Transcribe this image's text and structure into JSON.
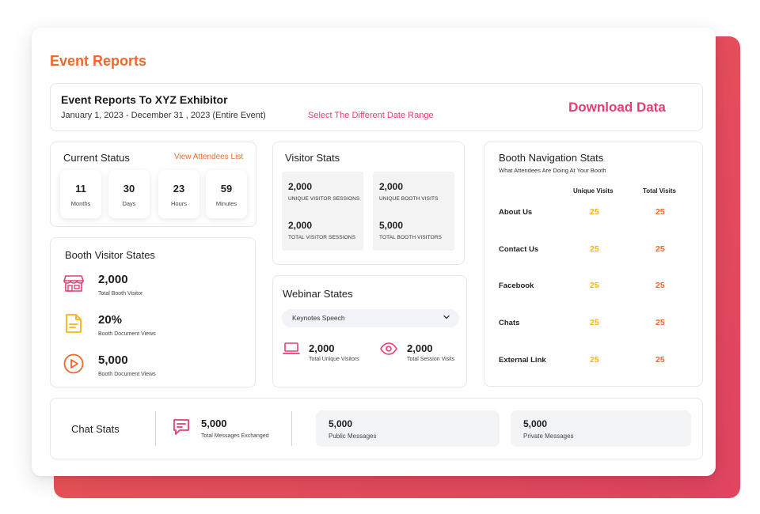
{
  "page_title": "Event Reports",
  "header": {
    "title": "Event Reports To XYZ Exhibitor",
    "date_range": "January 1, 2023 - December 31 , 2023 (Entire Event)",
    "select_range_link": "Select The Different Date Range",
    "download_label": "Download Data"
  },
  "current_status": {
    "title": "Current Status",
    "view_link": "View Attendees List",
    "boxes": [
      {
        "value": "11",
        "label": "Months"
      },
      {
        "value": "30",
        "label": "Days"
      },
      {
        "value": "23",
        "label": "Hours"
      },
      {
        "value": "59",
        "label": "Minutes"
      }
    ]
  },
  "booth_visitor_states": {
    "title": "Booth Visitor States",
    "items": [
      {
        "value": "2,000",
        "label": "Total Booth Visitor",
        "icon": "store-icon",
        "color": "#e53d72"
      },
      {
        "value": "20%",
        "label": "Booth Document Views",
        "icon": "document-icon",
        "color": "#f5b50f"
      },
      {
        "value": "5,000",
        "label": "Booth Document Views",
        "icon": "play-circle-icon",
        "color": "#f2672b"
      }
    ]
  },
  "visitor_stats": {
    "title": "Visitor Stats",
    "items": [
      {
        "value": "2,000",
        "label": "UNIQUE VISITOR SESSIONS"
      },
      {
        "value": "2,000",
        "label": "UNIQUE BOOTH VISITS"
      },
      {
        "value": "2,000",
        "label": "TOTAL VISITOR SESSIONS"
      },
      {
        "value": "5,000",
        "label": "TOTAL BOOTH VISITORS"
      }
    ]
  },
  "webinar_states": {
    "title": "Webinar States",
    "selected_option": "Keynotes Speech",
    "stats": [
      {
        "value": "2,000",
        "label": "Total Unique Visitors",
        "icon": "laptop-icon"
      },
      {
        "value": "2,000",
        "label": "Total Session Visits",
        "icon": "eye-icon"
      }
    ]
  },
  "booth_navigation": {
    "title": "Booth Navigation Stats",
    "subtitle": "What Attendees Are Doing At Your Booth",
    "col_unique": "Unique Visits",
    "col_total": "Total Visits",
    "rows": [
      {
        "label": "About Us",
        "unique": "25",
        "total": "25"
      },
      {
        "label": "Contact Us",
        "unique": "25",
        "total": "25"
      },
      {
        "label": "Facebook",
        "unique": "25",
        "total": "25"
      },
      {
        "label": "Chats",
        "unique": "25",
        "total": "25"
      },
      {
        "label": "External Link",
        "unique": "25",
        "total": "25"
      }
    ]
  },
  "chat_stats": {
    "title": "Chat Stats",
    "total_value": "5,000",
    "total_label": "Total Messages Exchanged",
    "public_value": "5,000",
    "public_label": "Public Messages",
    "private_value": "5,000",
    "private_label": "Private Messages"
  },
  "colors": {
    "orange": "#f2672b",
    "pink": "#e53d72",
    "yellow": "#f5b50f"
  }
}
